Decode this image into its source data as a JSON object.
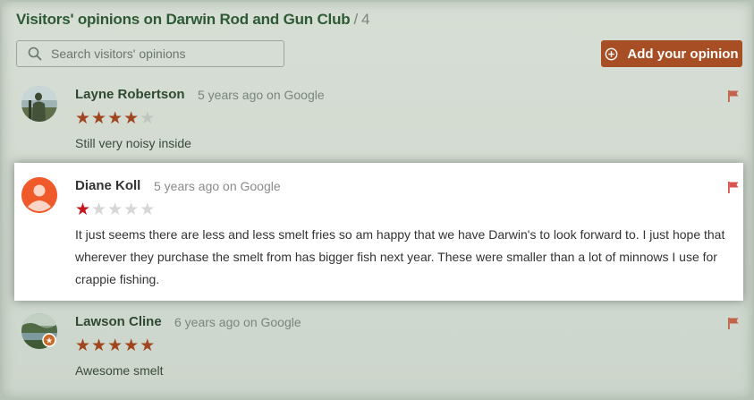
{
  "header": {
    "title": "Visitors' opinions on Darwin Rod and Gun Club",
    "separator": "/",
    "count": "4"
  },
  "search": {
    "placeholder": "Search visitors' opinions"
  },
  "add_button": {
    "label": "Add your opinion"
  },
  "reviews": [
    {
      "name": "Layne Robertson",
      "meta": "5 years ago on Google",
      "rating": 4,
      "text": "Still very noisy inside"
    },
    {
      "name": "Diane Koll",
      "meta": "5 years ago on Google",
      "rating": 1,
      "text": "It just seems there are less and less smelt fries so am happy that we have Darwin's to look forward to. I just hope that wherever they purchase the smelt from has bigger fish next year. These were smaller than a lot of minnows I use for crappie fishing."
    },
    {
      "name": "Lawson Cline",
      "meta": "6 years ago on Google",
      "rating": 5,
      "text": "Awesome smelt"
    }
  ],
  "colors": {
    "accent": "#a74e25",
    "title_green": "#2d5a35",
    "star_on": "#a0461f",
    "star_on_low": "#c4161c",
    "flag": "#c0634a"
  },
  "icons": {
    "search": "search-icon",
    "add": "plus-circle-icon",
    "flag": "flag-icon"
  }
}
